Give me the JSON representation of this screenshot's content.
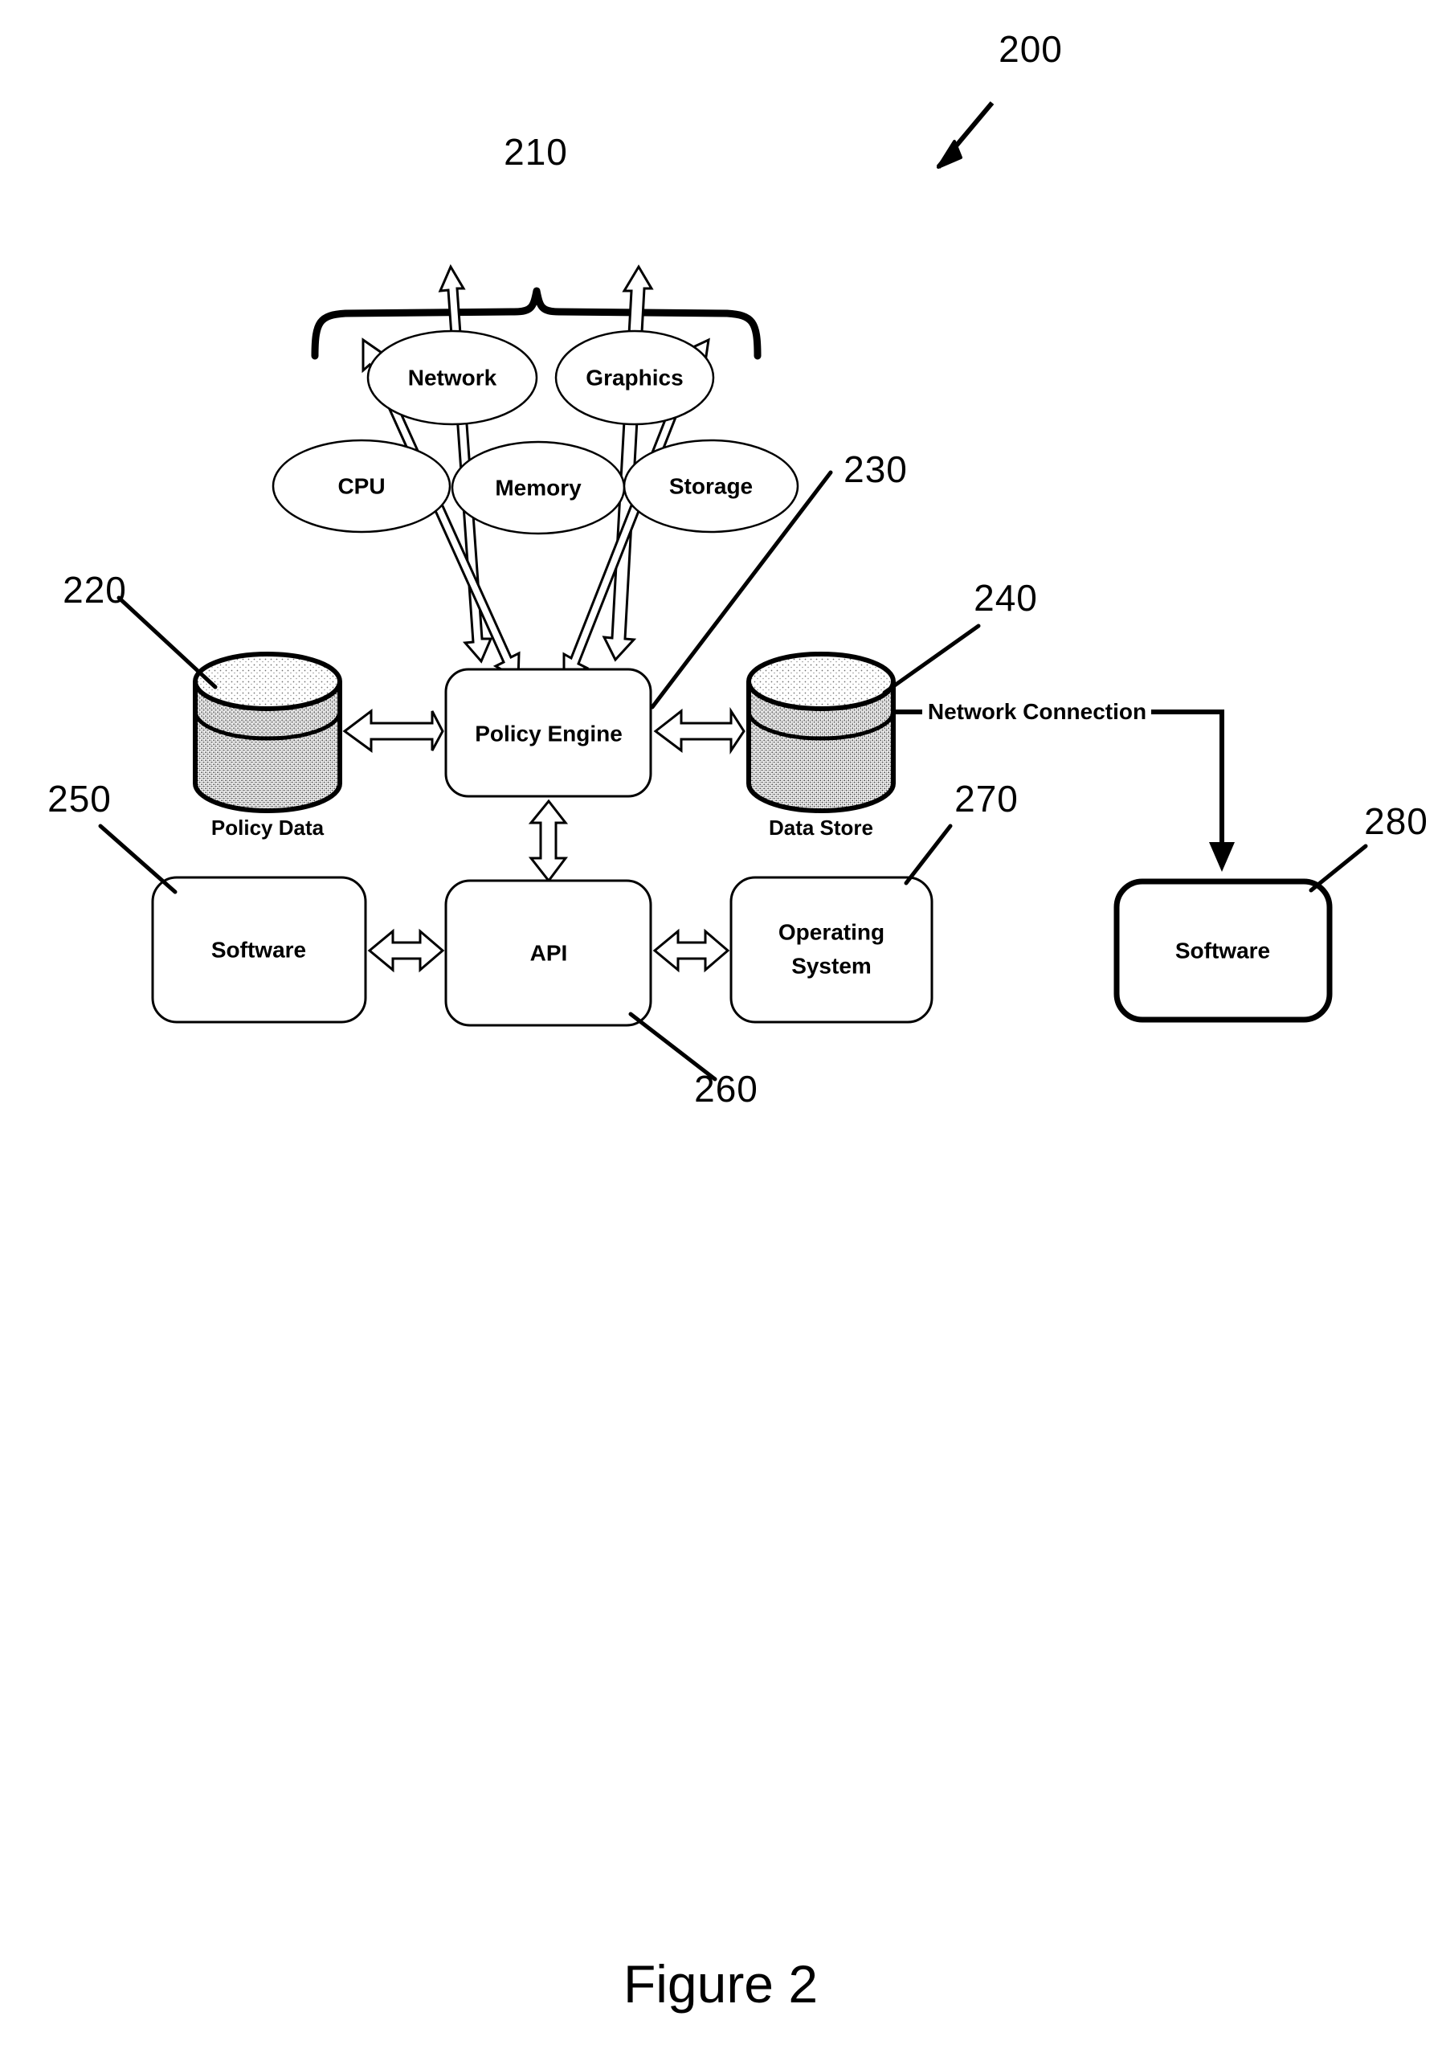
{
  "figure": {
    "caption": "Figure 2",
    "system_ref": "200"
  },
  "resource_cluster": {
    "ref": "210",
    "brace": "curly-brace",
    "resources": [
      {
        "id": "network",
        "label": "Network"
      },
      {
        "id": "graphics",
        "label": "Graphics"
      },
      {
        "id": "cpu",
        "label": "CPU"
      },
      {
        "id": "memory",
        "label": "Memory"
      },
      {
        "id": "storage",
        "label": "Storage"
      }
    ]
  },
  "policy_engine": {
    "label": "Policy Engine",
    "ref": "230"
  },
  "policy_data": {
    "label": "Policy Data",
    "ref": "220"
  },
  "data_store": {
    "label": "Data Store",
    "ref": "240"
  },
  "software_local": {
    "label": "Software",
    "ref": "250"
  },
  "api": {
    "label": "API",
    "ref": "260"
  },
  "operating_system": {
    "label_line1": "Operating",
    "label_line2": "System",
    "ref": "270"
  },
  "software_remote": {
    "label": "Software",
    "ref": "280"
  },
  "network_connection": {
    "label": "Network Connection"
  },
  "colors": {
    "ink": "#000000",
    "paper": "#ffffff",
    "cylinder_top_shade": "#d8d8d8",
    "cylinder_body_shade": "#a8a8a8"
  }
}
